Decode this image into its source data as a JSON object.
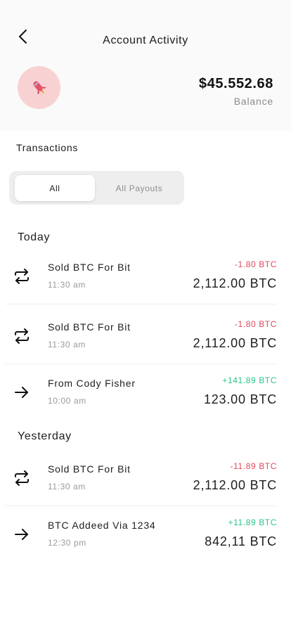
{
  "header": {
    "title": "Account Activity",
    "back_icon": "chevron-left-icon",
    "avatar_icon": "rocket-icon",
    "balance_amount": "$45.552.68",
    "balance_label": "Balance"
  },
  "transactions": {
    "title": "Transactions",
    "tabs": [
      {
        "label": "All",
        "selected": true
      },
      {
        "label": "All Payouts",
        "selected": false
      }
    ]
  },
  "groups": [
    {
      "label": "Today",
      "items": [
        {
          "icon": "exchange-icon",
          "name": "Sold BTC For Bit",
          "time": "11:30 am",
          "change": "-1.80 BTC",
          "change_type": "negative",
          "amount": "2,112.00 BTC"
        },
        {
          "icon": "exchange-icon",
          "name": "Sold BTC For Bit",
          "time": "11:30 am",
          "change": "-1.80 BTC",
          "change_type": "negative",
          "amount": "2,112.00 BTC"
        },
        {
          "icon": "arrow-right-icon",
          "name": "From Cody Fisher",
          "time": "10:00 am",
          "change": "+141.89 BTC",
          "change_type": "positive",
          "amount": "123.00 BTC"
        }
      ]
    },
    {
      "label": "Yesterday",
      "items": [
        {
          "icon": "exchange-icon",
          "name": "Sold BTC For Bit",
          "time": "11:30 am",
          "change": "-11.89 BTC",
          "change_type": "negative",
          "amount": "2,112.00 BTC"
        },
        {
          "icon": "arrow-right-icon",
          "name": "BTC Addeed Via 1234",
          "time": "12:30 pm",
          "change": "+11.89 BTC",
          "change_type": "positive",
          "amount": "842,11 BTC"
        }
      ]
    }
  ],
  "colors": {
    "negative": "#e0475b",
    "positive": "#2bc48a",
    "avatar_bg": "#f8d2d2"
  }
}
